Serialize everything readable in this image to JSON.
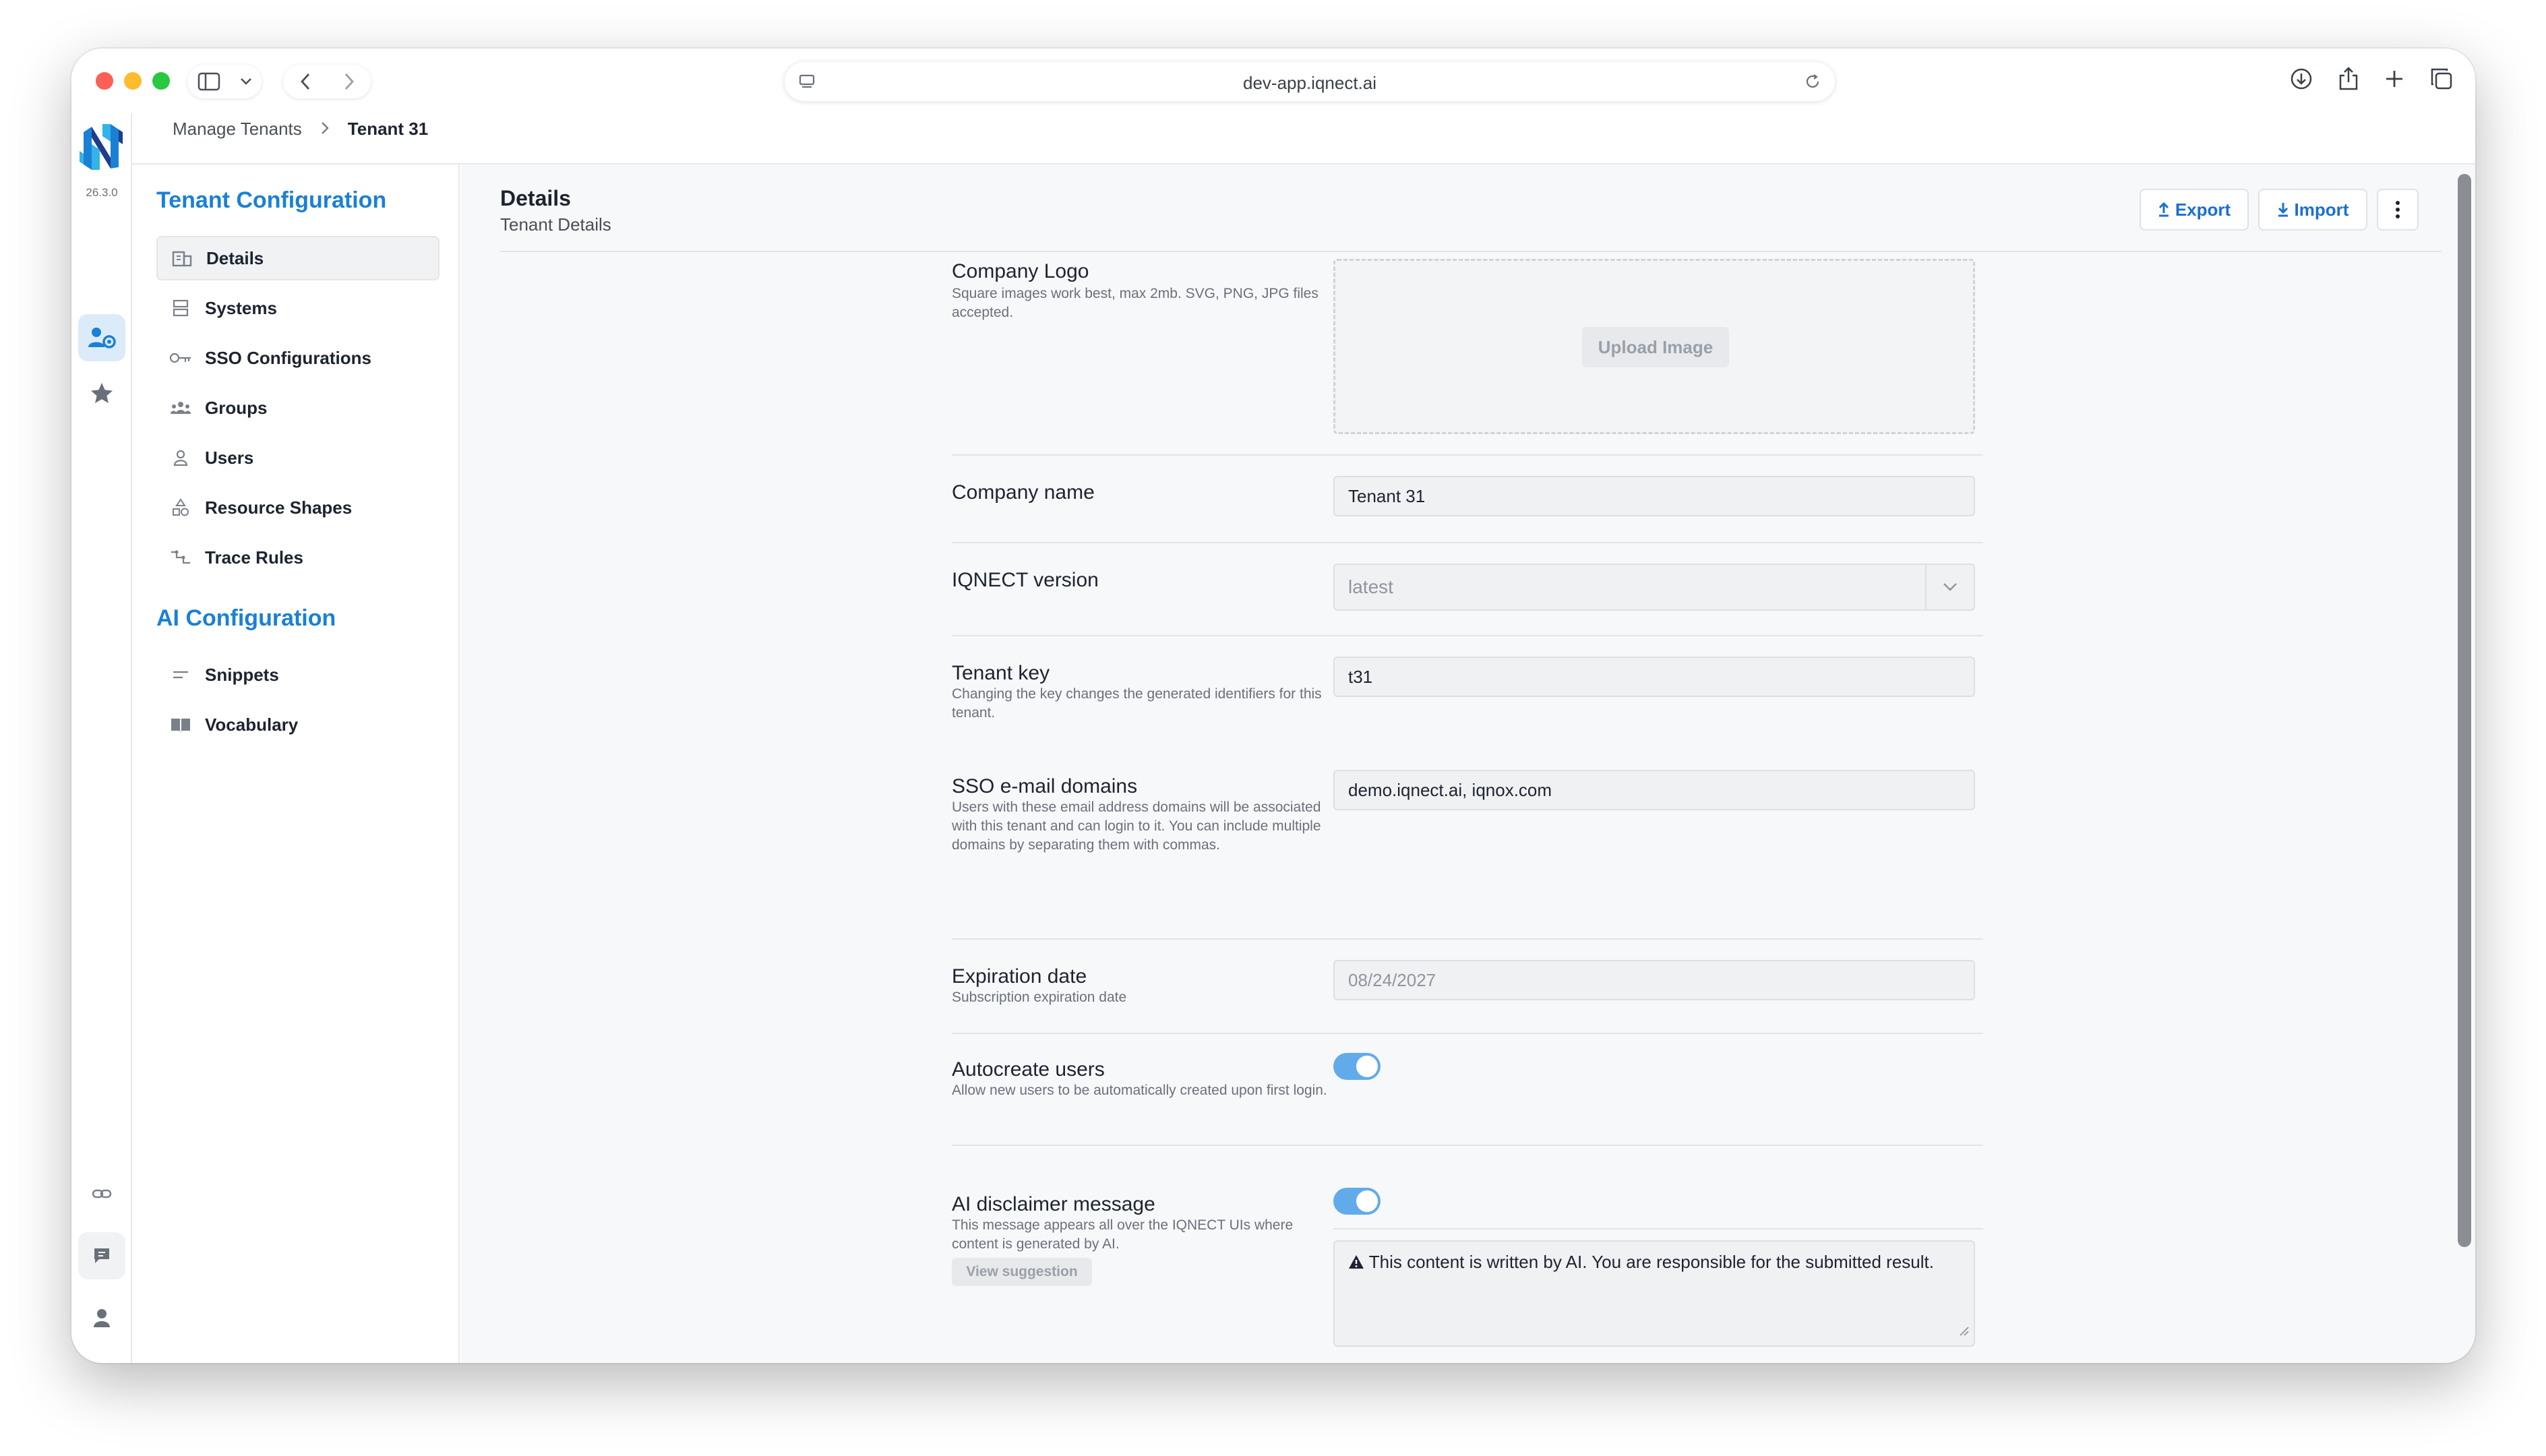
{
  "browser": {
    "url": "dev-app.iqnect.ai"
  },
  "app": {
    "version": "26.3.0"
  },
  "breadcrumb": {
    "parent": "Manage Tenants",
    "current": "Tenant 31"
  },
  "sidebar": {
    "tenant_section": "Tenant Configuration",
    "tenant_items": [
      {
        "label": "Details",
        "icon": "building-icon"
      },
      {
        "label": "Systems",
        "icon": "server-icon"
      },
      {
        "label": "SSO Configurations",
        "icon": "key-icon"
      },
      {
        "label": "Groups",
        "icon": "group-icon"
      },
      {
        "label": "Users",
        "icon": "user-icon"
      },
      {
        "label": "Resource Shapes",
        "icon": "shapes-icon"
      },
      {
        "label": "Trace Rules",
        "icon": "trace-icon"
      }
    ],
    "ai_section": "AI Configuration",
    "ai_items": [
      {
        "label": "Snippets",
        "icon": "lines-icon"
      },
      {
        "label": "Vocabulary",
        "icon": "book-icon"
      }
    ]
  },
  "header": {
    "title": "Details",
    "subtitle": "Tenant Details",
    "export_label": "Export",
    "import_label": "Import"
  },
  "form": {
    "logo": {
      "label": "Company Logo",
      "help": "Square images work best, max 2mb. SVG, PNG, JPG files accepted.",
      "upload_label": "Upload Image"
    },
    "company_name": {
      "label": "Company name",
      "value": "Tenant 31"
    },
    "version": {
      "label": "IQNECT version",
      "value": "latest"
    },
    "tenant_key": {
      "label": "Tenant key",
      "help": "Changing the key changes the generated identifiers for this tenant.",
      "value": "t31"
    },
    "sso_domains": {
      "label": "SSO e-mail domains",
      "help": "Users with these email address domains will be associated with this tenant and can login to it. You can include multiple domains by separating them with commas.",
      "value": "demo.iqnect.ai, iqnox.com"
    },
    "expiration": {
      "label": "Expiration date",
      "help": "Subscription expiration date",
      "value": "08/24/2027"
    },
    "autocreate": {
      "label": "Autocreate users",
      "help": "Allow new users to be automatically created upon first login.",
      "enabled": true
    },
    "disclaimer": {
      "label": "AI disclaimer message",
      "help": "This message appears all over the IQNECT UIs where content is generated by AI.",
      "suggestion_label": "View suggestion",
      "enabled": true,
      "value": "This content is written by AI. You are responsible for the submitted result."
    }
  },
  "colors": {
    "accent": "#1a80d6",
    "toggle_on": "#62abea"
  }
}
